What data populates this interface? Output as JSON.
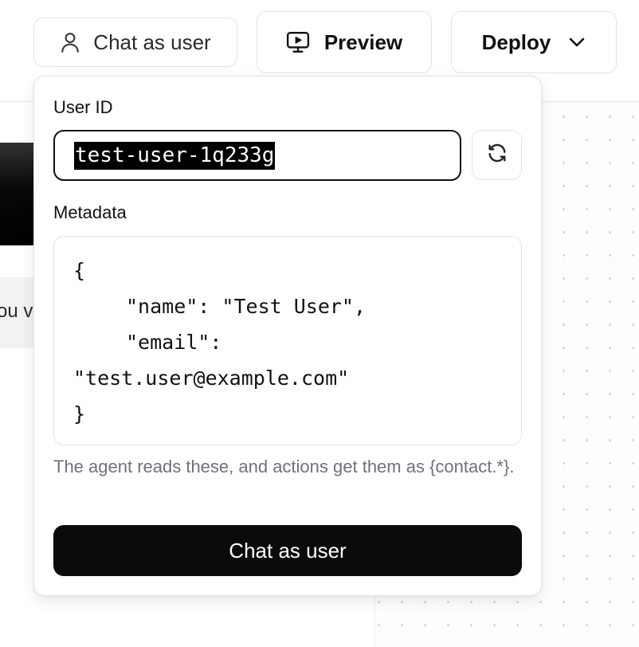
{
  "toolbar": {
    "chat_as_user_label": "Chat as user",
    "preview_label": "Preview",
    "deploy_label": "Deploy"
  },
  "background": {
    "partial_text": "ou v"
  },
  "popover": {
    "user_id_label": "User ID",
    "user_id_value": "test-user-1q233g",
    "metadata_label": "Metadata",
    "metadata_lines": [
      "{",
      "\"name\": \"Test User\",",
      "\"email\":",
      "\"test.user@example.com\"",
      "}"
    ],
    "help_text": "The agent reads these, and actions get them as {contact.*}.",
    "submit_label": "Chat as user"
  },
  "icons": {
    "chat_as_user": "user-icon",
    "preview": "monitor-play-icon",
    "deploy": "chevron-down-icon",
    "refresh": "refresh-icon"
  },
  "colors": {
    "border": "#e4e4e7",
    "primary_button": "#0b0b0c",
    "help_text": "#70717a",
    "selection": "#000000"
  }
}
